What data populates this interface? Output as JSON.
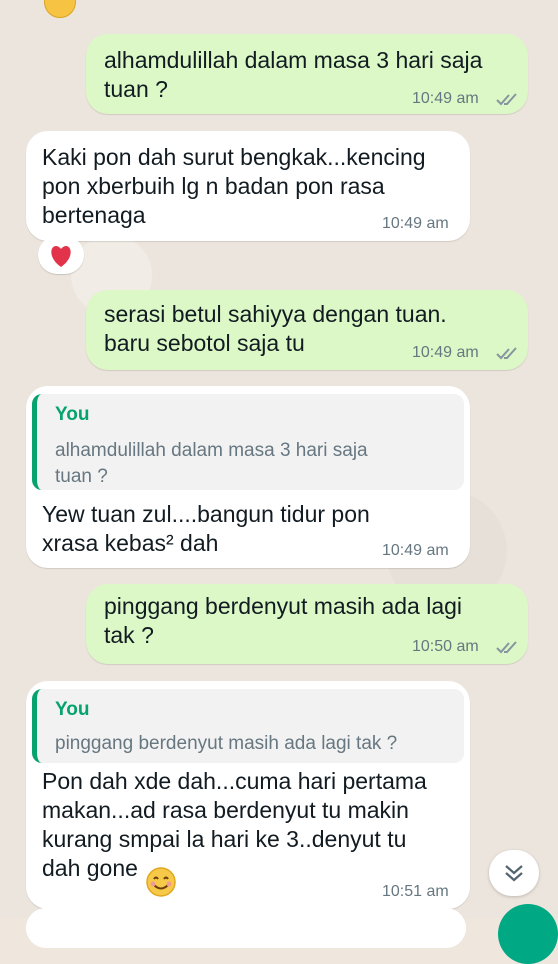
{
  "messages": [
    {
      "direction": "outgoing",
      "text": "alhamdulillah dalam masa 3 hari saja\ntuan ?",
      "time": "10:49 am"
    },
    {
      "direction": "incoming",
      "text": "Kaki pon dah surut bengkak...kencing\npon xberbuih lg n badan pon rasa\nbertenaga",
      "time": "10:49 am",
      "reaction": "heart"
    },
    {
      "direction": "outgoing",
      "text": "serasi betul sahiyya dengan tuan.\nbaru sebotol saja tu",
      "time": "10:49 am"
    },
    {
      "direction": "incoming",
      "quote_author": "You",
      "quote_text": "alhamdulillah dalam masa 3 hari saja\ntuan ?",
      "text": "Yew tuan zul....bangun tidur pon\nxrasa kebas² dah",
      "time": "10:49 am"
    },
    {
      "direction": "outgoing",
      "text": "pinggang berdenyut masih ada lagi\ntak ?",
      "time": "10:50 am"
    },
    {
      "direction": "incoming",
      "quote_author": "You",
      "quote_text": "pinggang berdenyut masih ada lagi tak ?",
      "text": "Pon dah xde dah...cuma hari pertama\nmakan...ad rasa berdenyut tu makin\nkurang smpai la hari ke 3..denyut tu\ndah gone",
      "time": "10:51 am",
      "emoji": "smiling-face"
    }
  ],
  "colors": {
    "outgoing": "#dcf8c6",
    "incoming": "#ffffff",
    "quote_accent": "#06a36f",
    "read_ticks": "#8696a0"
  },
  "icons": {
    "scroll_down": "double-chevron-down-icon",
    "reaction": "heart-icon"
  }
}
